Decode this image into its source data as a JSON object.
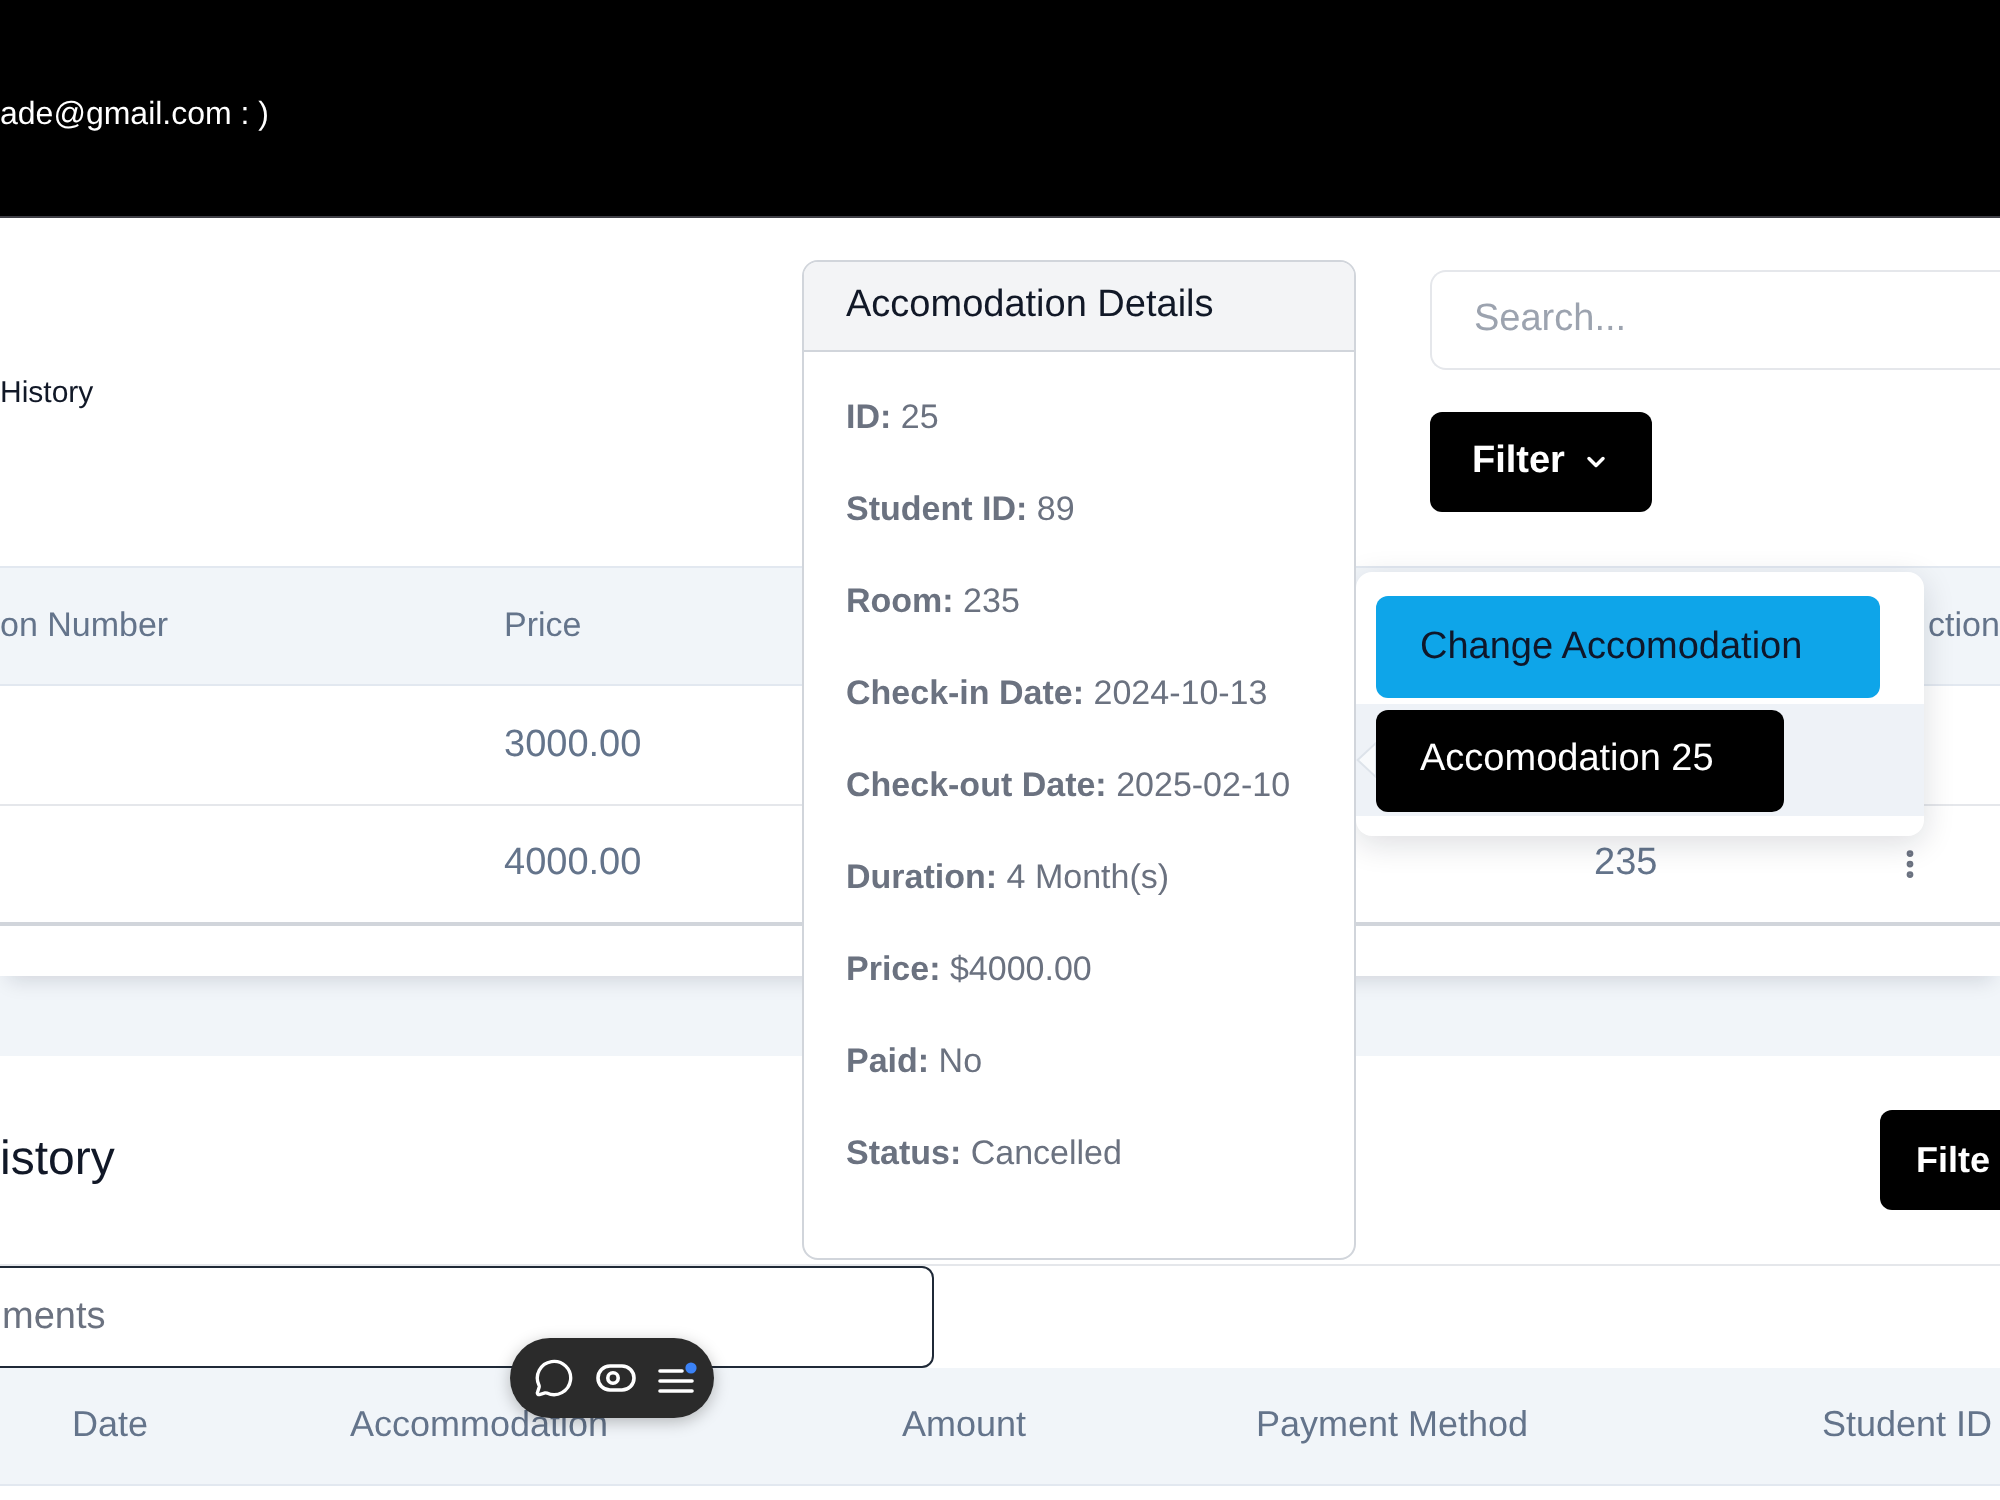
{
  "header": {
    "user_text": "ade@gmail.com : )"
  },
  "accommodations": {
    "title": "History",
    "search": {
      "placeholder": "Search..."
    },
    "filter_button": {
      "label": "Filter"
    },
    "table": {
      "columns": [
        "on Number",
        "Price",
        "ction"
      ],
      "rows": [
        {
          "price": "3000.00",
          "menu_open": true
        },
        {
          "price": "4000.00",
          "column_4": "235",
          "menu_open": false
        }
      ]
    }
  },
  "row_menu": {
    "action_button": {
      "label": "Change Accomodation"
    },
    "tooltip": {
      "text": "Accomodation 25"
    }
  },
  "details_popover": {
    "title": "Accomodation Details",
    "fields": [
      "**ID:** 25",
      "**Student ID:** 89",
      "**Room:** 235",
      "**Check-in Date:** 2024-10-13",
      "**Check-out Date:** 2025-02-10",
      "**Duration:** 4 Month(s)",
      "**Price:** $4000.00",
      "**Paid:** No",
      "**Status:** Cancelled"
    ]
  },
  "payments": {
    "title": "istory",
    "filter_button": {
      "label": "Filte"
    },
    "search": {
      "placeholder": "ments"
    },
    "table": {
      "columns": [
        "Date",
        "Accommodation",
        "Amount",
        "Payment Method",
        "Student ID"
      ]
    }
  }
}
